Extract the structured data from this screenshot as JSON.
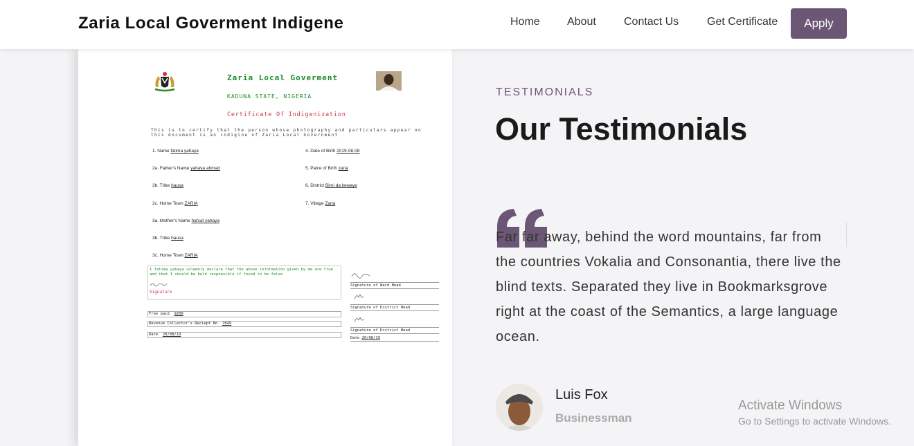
{
  "navbar": {
    "brand": "Zaria Local Goverment Indigene",
    "links": [
      "Home",
      "About",
      "Contact Us",
      "Get Certificate"
    ],
    "apply_label": "Apply"
  },
  "certificate": {
    "title": "Zaria Local Goverment",
    "state": "KADUNA STATE, NIGERIA",
    "heading": "Certificate Of Indigenization",
    "intro": "This is to certify that the person whose photography and particulars appear on this document is an indigine of Zaria Local Government",
    "left_fields": [
      {
        "label": "1. Name",
        "value": "fatima yahaya"
      },
      {
        "label": "2a. Father's Name",
        "value": "yahaya ahmad"
      },
      {
        "label": "2b. Tribe",
        "value": "hausa"
      },
      {
        "label": "2c. Home Town",
        "value": "ZARIA"
      },
      {
        "label": "3a. Mother's Name",
        "value": "hafsat yahaya"
      },
      {
        "label": "3b. Tribe",
        "value": "hausa"
      },
      {
        "label": "3c. Home Town",
        "value": "ZARIA"
      }
    ],
    "right_fields": [
      {
        "label": "4. Date of Birth",
        "value": "2019-08-08"
      },
      {
        "label": "5. Palce of Birth",
        "value": "zaria"
      },
      {
        "label": "6. District",
        "value": "Birni da kewaye"
      },
      {
        "label": "7. Village",
        "value": "Zaria"
      }
    ],
    "declaration": "I fatima yahaya solemnly declare that the above information given by me are true and that I should be held responsible if found to be false",
    "signature_label": "Signature",
    "fee_label": "Free paid",
    "fee_value": "9200",
    "receipt_label": "Revenue Collector's Reciept No",
    "receipt_value": "7849",
    "date_label": "Date",
    "date_value": "20/08/19",
    "ward_head_label": "Signature of Ward Head",
    "district_head_label": "Signature of District Head",
    "district_head_label_2": "Signature of District Head",
    "right_date_label": "Date",
    "right_date_value": "20/08/19"
  },
  "testimonials": {
    "eyebrow": "TESTIMONIALS",
    "heading": "Our Testimonials",
    "quote": "Far far away, behind the word mountains, far from the countries Vokalia and Consonantia, there live the blind texts. Separated they live in Bookmarksgrove right at the coast of the Semantics, a large language ocean.",
    "author_name": "Luis Fox",
    "author_role": "Businessman"
  },
  "watermark": {
    "title": "Activate Windows",
    "subtitle": "Go to Settings to activate Windows."
  },
  "colors": {
    "accent": "#6c5676",
    "cert_green": "#1a8a2a",
    "cert_red": "#c83a4a"
  }
}
